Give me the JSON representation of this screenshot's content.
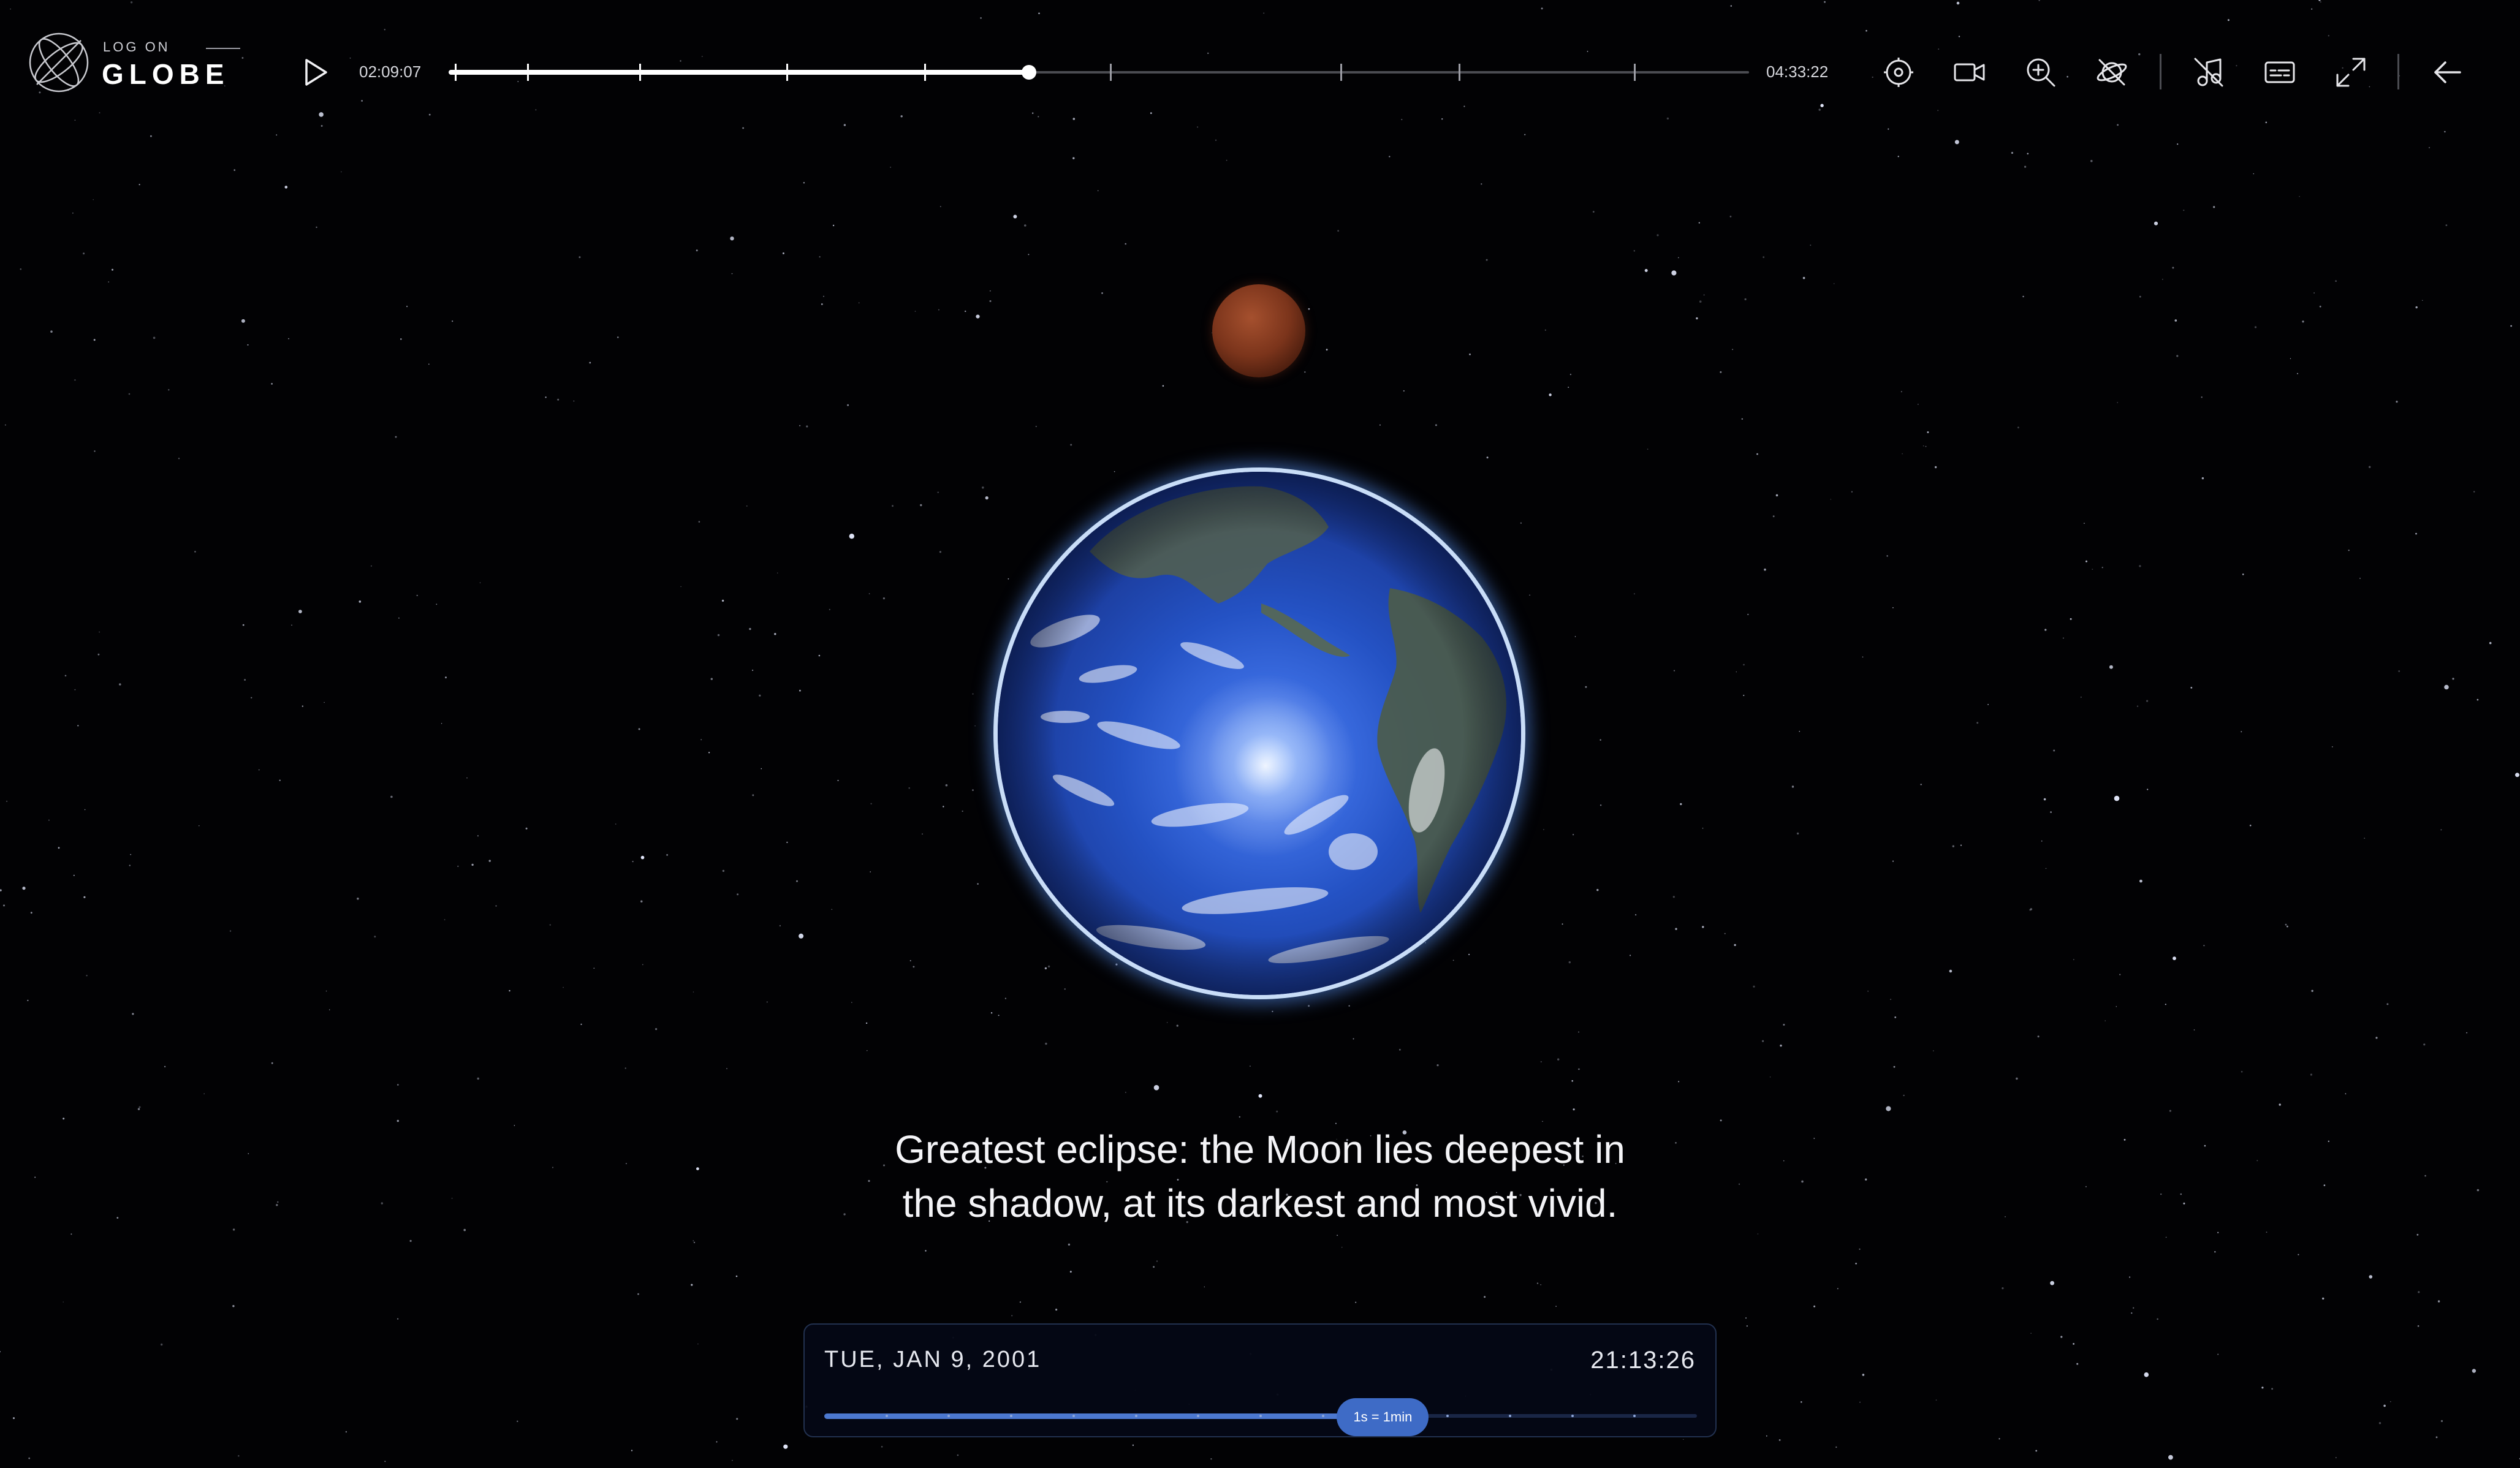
{
  "app": {
    "logo_top": "LOG ON",
    "logo_main": "GLOBE"
  },
  "player": {
    "elapsed": "02:09:07",
    "total": "04:33:22",
    "progress": 0.4465,
    "markers": [
      0.005,
      0.061,
      0.147,
      0.26,
      0.366,
      0.509,
      0.686,
      0.777,
      0.912
    ],
    "play_icon": "play-icon"
  },
  "toolbar": {
    "tools": [
      "target-icon",
      "video-camera-icon",
      "zoom-in-icon",
      "satellite-off-icon",
      "music-note-off-icon",
      "captions-icon",
      "fullscreen-icon"
    ],
    "back_icon": "arrow-left-icon"
  },
  "caption": {
    "line1": "Greatest eclipse: the Moon lies deepest in",
    "line2": "the shadow, at its darkest and most vivid."
  },
  "date_panel": {
    "date": "TUE, JAN 9, 2001",
    "time": "21:13:26",
    "speed_label": "1s = 1min",
    "speed_position": 0.64
  },
  "colors": {
    "background": "#020204",
    "accent": "#3e6bc6",
    "moon": "#7b341b",
    "earth_ocean": "#2452c4"
  }
}
